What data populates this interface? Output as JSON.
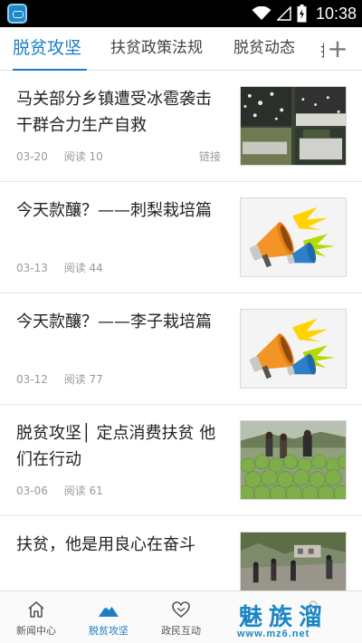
{
  "status_bar": {
    "time": "10:38",
    "icons": [
      "app-icon",
      "wifi-icon",
      "signal-icon",
      "battery-icon"
    ]
  },
  "tabs": [
    {
      "label": "脱贫攻坚",
      "active": true
    },
    {
      "label": "扶贫政策法规",
      "active": false
    },
    {
      "label": "脱贫动态",
      "active": false
    }
  ],
  "tab_add_icon": "plus-icon",
  "news": [
    {
      "title": "马关部分乡镇遭受冰雹袭击 干群合力生产自救",
      "date": "03-20",
      "reads": "阅读 10",
      "tag": "链接",
      "thumb": "photo-hail"
    },
    {
      "title": "今天款釀？——刺梨栽培篇",
      "date": "03-13",
      "reads": "阅读 44",
      "tag": "",
      "thumb": "megaphones"
    },
    {
      "title": "今天款釀？——李子栽培篇",
      "date": "03-12",
      "reads": "阅读 77",
      "tag": "",
      "thumb": "megaphones"
    },
    {
      "title": "脱贫攻坚│ 定点消费扶贫 他们在行动",
      "date": "03-06",
      "reads": "阅读 61",
      "tag": "",
      "thumb": "photo-cabbage"
    },
    {
      "title": "扶贫，他是用良心在奋斗",
      "date": "",
      "reads": "",
      "tag": "",
      "thumb": "photo-road"
    }
  ],
  "bottom_nav": [
    {
      "label": "新闻中心",
      "icon": "home-icon",
      "active": false
    },
    {
      "label": "脱贫攻坚",
      "icon": "mountain-icon",
      "active": true
    },
    {
      "label": "政民互动",
      "icon": "heart-icon",
      "active": false
    },
    {
      "label": "",
      "icon": "lock-icon",
      "active": false
    }
  ],
  "watermark": {
    "brand": "魅族溜",
    "url": "www.mz6.net"
  },
  "colors": {
    "accent": "#1a7fc3",
    "meta_text": "#9a9a9a",
    "status_bar": "#000000"
  }
}
